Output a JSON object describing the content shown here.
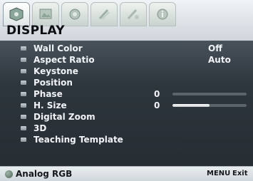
{
  "menu": {
    "title": "DISPLAY",
    "tabs": [
      {
        "icon": "display-icon",
        "active": true
      },
      {
        "icon": "picture-icon",
        "active": false
      },
      {
        "icon": "source-icon",
        "active": false
      },
      {
        "icon": "settings-icon",
        "active": false
      },
      {
        "icon": "advanced-settings-icon",
        "active": false
      },
      {
        "icon": "information-icon",
        "active": false
      }
    ]
  },
  "items": [
    {
      "label": "Wall Color",
      "value": "Off"
    },
    {
      "label": "Aspect Ratio",
      "value": "Auto"
    },
    {
      "label": "Keystone"
    },
    {
      "label": "Position"
    },
    {
      "label": "Phase",
      "value": "0",
      "slider_fraction": 0.0
    },
    {
      "label": "H. Size",
      "value": "0",
      "slider_fraction": 0.5
    },
    {
      "label": "Digital Zoom"
    },
    {
      "label": "3D"
    },
    {
      "label": "Teaching Template"
    }
  ],
  "footer": {
    "source": "Analog RGB",
    "menu_key": "MENU",
    "exit_label": "Exit"
  }
}
